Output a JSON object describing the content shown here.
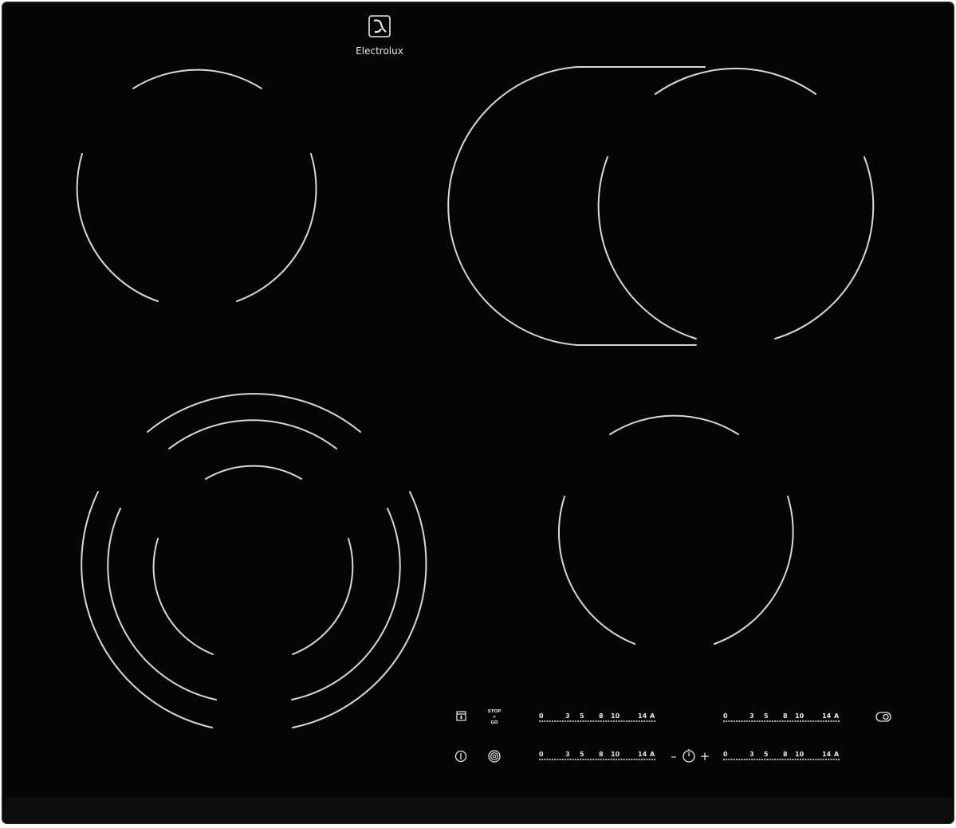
{
  "brand": {
    "name": "Electrolux",
    "logo_icon": "electrolux-logo-icon"
  },
  "colors": {
    "glass": "#050505",
    "edge": "#1a1a1a",
    "zone_lines": "#d8d8d8",
    "controls": "#e8e8e8"
  },
  "zones": [
    {
      "name": "cooking-zone-rear-left",
      "type": "single-circle"
    },
    {
      "name": "cooking-zone-rear-right",
      "type": "oval-extension"
    },
    {
      "name": "cooking-zone-front-left",
      "type": "triple-circle"
    },
    {
      "name": "cooking-zone-front-right",
      "type": "single-circle"
    }
  ],
  "controls": {
    "lock_icon": "child-lock-icon",
    "stop_go": {
      "line1": "STOP",
      "line2": "+",
      "line3": "GO"
    },
    "power_icon": "power-icon",
    "bridge_icon": "zone-bridge-icon",
    "timer_minus": "–",
    "timer_plus": "+",
    "timer_icon": "timer-icon",
    "extension_icon": "zone-extension-icon",
    "slider_labels": [
      "0",
      "3",
      "5",
      "8",
      "10",
      "14",
      "A"
    ],
    "sliders": [
      {
        "name": "power-slider-rear-left"
      },
      {
        "name": "power-slider-rear-right"
      },
      {
        "name": "power-slider-front-left"
      },
      {
        "name": "power-slider-front-right"
      }
    ]
  }
}
